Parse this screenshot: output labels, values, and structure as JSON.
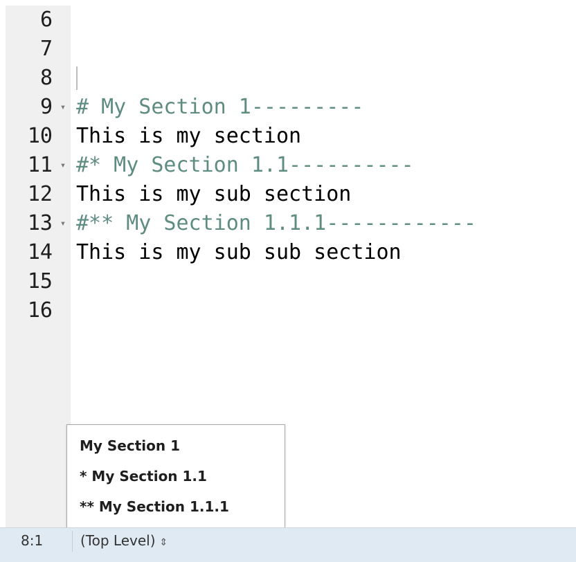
{
  "editor": {
    "lines": [
      {
        "number": "6",
        "text": "",
        "fold": "",
        "kind": "code"
      },
      {
        "number": "7",
        "text": "",
        "fold": "",
        "kind": "code"
      },
      {
        "number": "8",
        "text": "",
        "fold": "",
        "kind": "code"
      },
      {
        "number": "9",
        "text": "# My Section 1---------",
        "fold": "▾",
        "kind": "comment"
      },
      {
        "number": "10",
        "text": "This is my section",
        "fold": "",
        "kind": "code"
      },
      {
        "number": "11",
        "text": "#* My Section 1.1----------",
        "fold": "▾",
        "kind": "comment"
      },
      {
        "number": "12",
        "text": "This is my sub section",
        "fold": "",
        "kind": "code"
      },
      {
        "number": "13",
        "text": "#** My Section 1.1.1------------",
        "fold": "▾",
        "kind": "comment"
      },
      {
        "number": "14",
        "text": "This is my sub sub section",
        "fold": "",
        "kind": "code"
      },
      {
        "number": "15",
        "text": "",
        "fold": "",
        "kind": "code"
      },
      {
        "number": "16",
        "text": "",
        "fold": "",
        "kind": "code"
      }
    ],
    "colors": {
      "comment": "#5e8c81",
      "code": "#000000",
      "gutter": "#f0f0f0"
    }
  },
  "popup": {
    "items": [
      {
        "label": "My Section 1"
      },
      {
        "label": "* My Section 1.1"
      },
      {
        "label": "** My Section 1.1.1"
      }
    ]
  },
  "status_bar": {
    "cursor_position": "8:1",
    "scope_label": "(Top Level)",
    "scope_arrow": "⇕",
    "background": "#dfeaf3"
  }
}
